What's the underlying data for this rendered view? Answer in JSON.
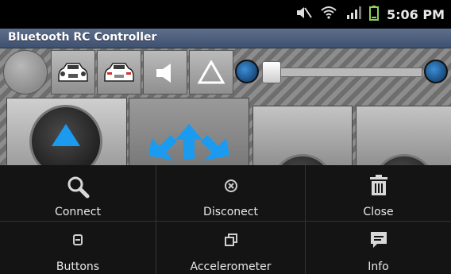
{
  "status_bar": {
    "time": "5:06 PM",
    "icons": [
      "mute-icon",
      "wifi-icon",
      "signal-icon",
      "battery-icon"
    ]
  },
  "app": {
    "title": "Bluetooth RC Controller"
  },
  "menu": {
    "items": [
      {
        "label": "Connect",
        "icon": "search-icon"
      },
      {
        "label": "Disconect",
        "icon": "disconnect-icon"
      },
      {
        "label": "Close",
        "icon": "trash-icon"
      },
      {
        "label": "Buttons",
        "icon": "buttons-icon"
      },
      {
        "label": "Accelerometer",
        "icon": "accelerometer-icon"
      },
      {
        "label": "Info",
        "icon": "info-icon"
      }
    ]
  },
  "colors": {
    "accent_blue": "#1a9bf0",
    "title_bar": "#4b5e7d",
    "menu_bg": "#141414"
  }
}
